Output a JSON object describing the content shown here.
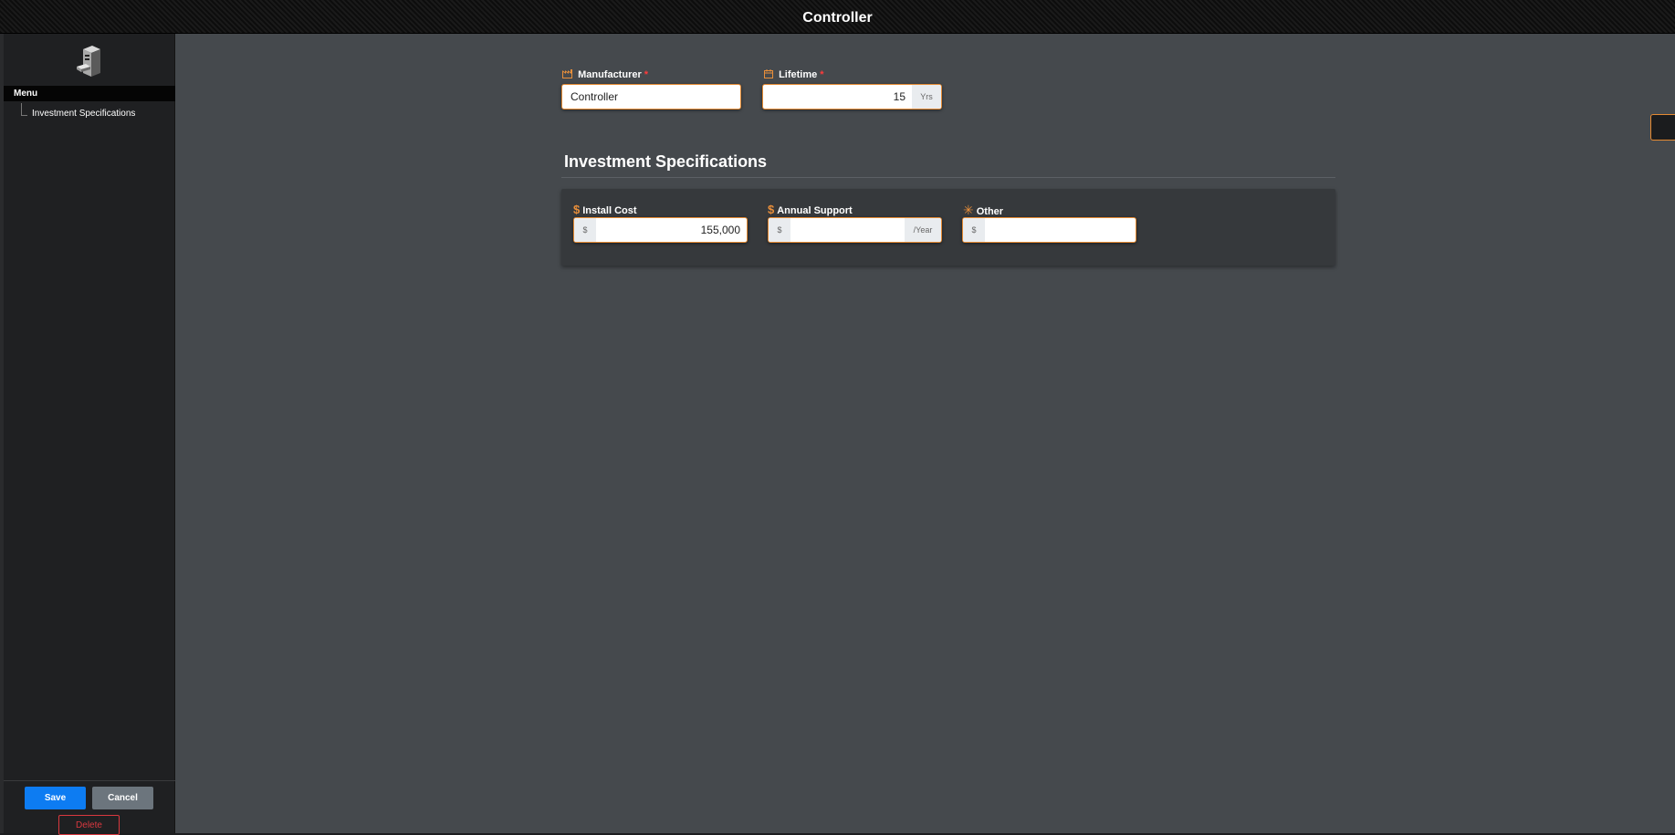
{
  "window": {
    "title": "Controller"
  },
  "sidebar": {
    "logo_icon": "controller-device-icon",
    "menu_header": "Menu",
    "items": [
      {
        "label": "Investment Specifications"
      }
    ],
    "save_label": "Save",
    "cancel_label": "Cancel",
    "delete_label": "Delete"
  },
  "form": {
    "manufacturer": {
      "label": "Manufacturer",
      "required": "*",
      "value": "Controller",
      "icon": "factory-icon"
    },
    "lifetime": {
      "label": "Lifetime",
      "required": "*",
      "value": "15",
      "unit": "Yrs",
      "icon": "calendar-icon"
    }
  },
  "investment": {
    "title": "Investment Specifications",
    "install_cost": {
      "label": "Install Cost",
      "prefix": "$",
      "value": "155,000",
      "icon": "dollar-icon"
    },
    "annual_support": {
      "label": "Annual Support",
      "prefix": "$",
      "value": "",
      "suffix": "/Year",
      "icon": "dollar-icon"
    },
    "other": {
      "label": "Other",
      "prefix": "$",
      "value": "",
      "icon": "asterisk-icon"
    }
  },
  "colors": {
    "accent": "#e58a32",
    "primary": "#0d7cf2",
    "danger": "#d9383f",
    "background": "#45494d"
  }
}
